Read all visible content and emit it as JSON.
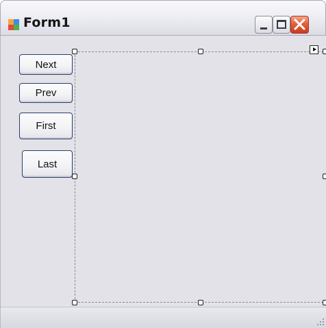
{
  "window": {
    "title": "Form1",
    "icon": "form-app-icon"
  },
  "caption_buttons": {
    "minimize_icon": "minimize-icon",
    "maximize_icon": "maximize-icon",
    "close_icon": "close-icon"
  },
  "buttons": {
    "next": "Next",
    "prev": "Prev",
    "first": "First",
    "last": "Last"
  },
  "designer": {
    "selected_control_icon": "smart-tag-icon",
    "resize_grip_icon": "size-grip-icon"
  },
  "colors": {
    "client_background": "#e2e2e8",
    "close_button": "#e2603a",
    "selection_border": "#8a8a94"
  }
}
